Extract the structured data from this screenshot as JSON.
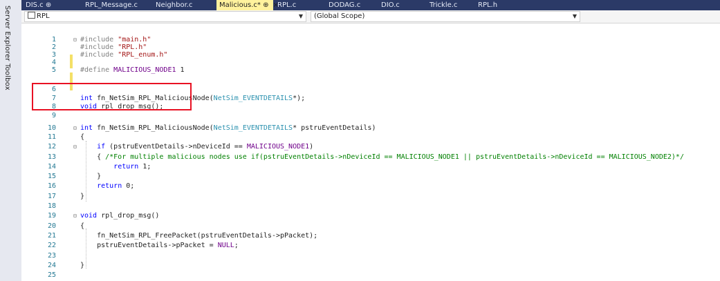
{
  "sidebar": {
    "items": [
      {
        "label": "Server Explorer"
      },
      {
        "label": "Toolbox"
      }
    ]
  },
  "tabs": [
    {
      "label": "DIS.c",
      "pin": "⊕"
    },
    {
      "label": "RPL_Message.c"
    },
    {
      "label": "Neighbor.c"
    },
    {
      "label": "Malicious.c*",
      "pin": "⊕",
      "close": "×",
      "active": true
    },
    {
      "label": "RPL.c"
    },
    {
      "label": "DODAG.c"
    },
    {
      "label": "DIO.c"
    },
    {
      "label": "Trickle.c"
    },
    {
      "label": "RPL.h"
    }
  ],
  "navbar": {
    "project": "RPL",
    "scope": "(Global Scope)"
  },
  "editor": {
    "lines": [
      {
        "n": "1",
        "text": "#include \"main.h\""
      },
      {
        "n": "2",
        "text": "#include \"RPL.h\""
      },
      {
        "n": "3",
        "text": "#include \"RPL_enum.h\""
      },
      {
        "n": "4",
        "text": ""
      },
      {
        "n": "5",
        "text": "#define MALICIOUS_NODE1 1"
      },
      {
        "n": "6",
        "text": ""
      },
      {
        "n": "7",
        "text": "int fn_NetSim_RPL_MaliciousNode(NetSim_EVENTDETAILS*);"
      },
      {
        "n": "8",
        "text": "void rpl_drop_msg();"
      },
      {
        "n": "9",
        "text": ""
      },
      {
        "n": "10",
        "text": "int fn_NetSim_RPL_MaliciousNode(NetSim_EVENTDETAILS* pstruEventDetails)"
      },
      {
        "n": "11",
        "text": "{"
      },
      {
        "n": "12",
        "text": "    if (pstruEventDetails->nDeviceId == MALICIOUS_NODE1)"
      },
      {
        "n": "13",
        "text": "    { /*For multiple malicious nodes use if(pstruEventDetails->nDeviceId == MALICIOUS_NODE1 || pstruEventDetails->nDeviceId == MALICIOUS_NODE2)*/"
      },
      {
        "n": "14",
        "text": "        return 1;"
      },
      {
        "n": "15",
        "text": "    }"
      },
      {
        "n": "16",
        "text": "    return 0;"
      },
      {
        "n": "17",
        "text": "}"
      },
      {
        "n": "18",
        "text": ""
      },
      {
        "n": "19",
        "text": "void rpl_drop_msg()"
      },
      {
        "n": "20",
        "text": "{"
      },
      {
        "n": "21",
        "text": "    fn_NetSim_RPL_FreePacket(pstruEventDetails->pPacket);"
      },
      {
        "n": "22",
        "text": "    pstruEventDetails->pPacket = NULL;"
      },
      {
        "n": "23",
        "text": ""
      },
      {
        "n": "24",
        "text": "}"
      },
      {
        "n": "25",
        "text": ""
      }
    ]
  }
}
